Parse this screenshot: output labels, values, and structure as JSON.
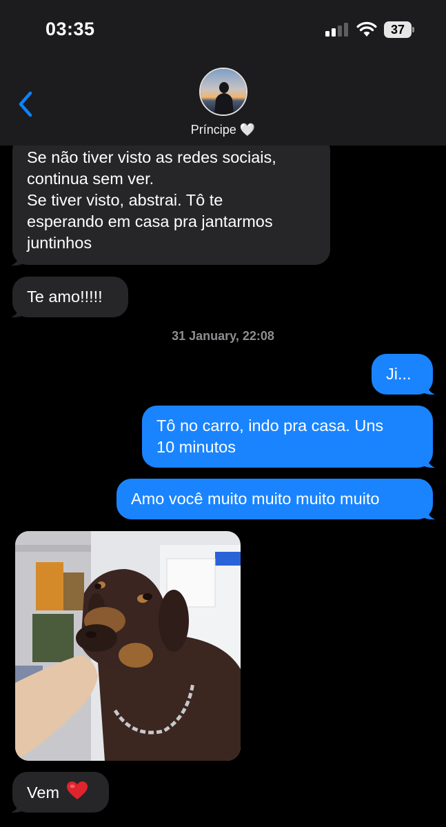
{
  "status_bar": {
    "time": "03:35",
    "battery": "37",
    "signal_icon": "signal-bars-icon",
    "wifi_icon": "wifi-icon"
  },
  "header": {
    "contact_name": "Príncipe 🤍",
    "back_icon": "chevron-left-icon"
  },
  "messages": {
    "m1": {
      "lines": [
        "Se não tiver visto as redes sociais,",
        "continua sem ver.",
        "Se tiver visto, abstrai. Tô te",
        "esperando em casa pra jantarmos",
        "juntinhos"
      ]
    },
    "m2": {
      "text": "Te amo!!!!!"
    },
    "timestamp": "31 January, 22:08",
    "m3": {
      "text": "Ji..."
    },
    "m4": {
      "lines": [
        "Tô no carro, indo pra casa. Uns",
        "10 minutos"
      ]
    },
    "m5": {
      "text": "Amo você muito muito muito muito"
    },
    "m6": {
      "text": "Vem"
    }
  },
  "colors": {
    "header_bg": "#1c1c1e",
    "incoming_bubble": "#262629",
    "outgoing_bubble": "#1a84ff",
    "accent": "#0a84ff"
  }
}
